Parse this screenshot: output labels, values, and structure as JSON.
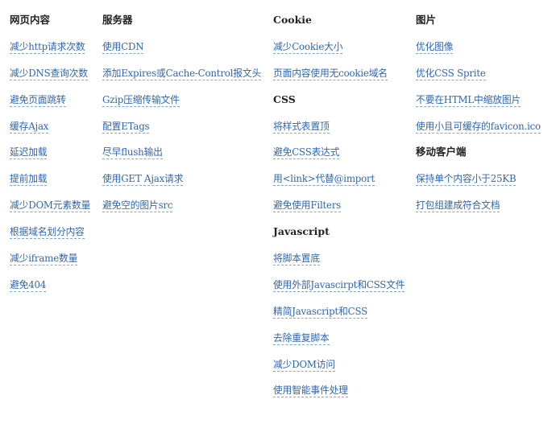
{
  "colors": {
    "link": "#2f66b0",
    "heading": "#222222",
    "underline": "#7fa6d6"
  },
  "columns": [
    {
      "sections": [
        {
          "heading": "网页内容",
          "items": [
            "减少http请求次数",
            "减少DNS查询次数",
            "避免页面跳转",
            "缓存Ajax",
            "延迟加载",
            "提前加载",
            "减少DOM元素数量",
            "根据域名划分内容",
            "减少iframe数量",
            "避免404"
          ]
        }
      ]
    },
    {
      "sections": [
        {
          "heading": "服务器",
          "items": [
            "使用CDN",
            "添加Expires或Cache-Control报文头",
            "Gzip压缩传输文件",
            "配置ETags",
            "尽早flush输出",
            "使用GET Ajax请求",
            "避免空的图片src"
          ]
        }
      ]
    },
    {
      "sections": [
        {
          "heading": "Cookie",
          "items": [
            "减少Cookie大小",
            "页面内容使用无cookie域名"
          ]
        },
        {
          "heading": "CSS",
          "items": [
            "将样式表置顶",
            "避免CSS表达式",
            "用<link>代替@import",
            "避免使用Filters"
          ]
        },
        {
          "heading": "Javascript",
          "items": [
            "将脚本置底",
            "使用外部Javascirpt和CSS文件",
            "精简Javascript和CSS",
            "去除重复脚本",
            "减少DOM访问",
            "使用智能事件处理"
          ]
        }
      ]
    },
    {
      "sections": [
        {
          "heading": "图片",
          "items": [
            "优化图像",
            "优化CSS Sprite",
            "不要在HTML中缩放图片",
            "使用小且可缓存的favicon.ico"
          ]
        },
        {
          "heading": "移动客户端",
          "items": [
            "保持单个内容小于25KB",
            "打包组建成符合文档"
          ]
        }
      ]
    }
  ]
}
